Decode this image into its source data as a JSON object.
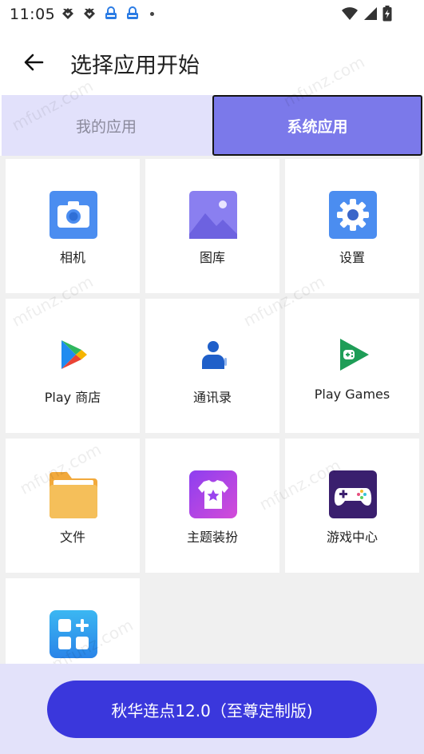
{
  "status_bar": {
    "time": "11:05"
  },
  "header": {
    "title": "选择应用开始"
  },
  "tabs": [
    {
      "label": "我的应用",
      "active": false
    },
    {
      "label": "系统应用",
      "active": true
    }
  ],
  "apps": [
    {
      "label": "相机",
      "icon": "camera-icon"
    },
    {
      "label": "图库",
      "icon": "gallery-icon"
    },
    {
      "label": "设置",
      "icon": "settings-gear-icon"
    },
    {
      "label": "Play 商店",
      "icon": "play-store-icon"
    },
    {
      "label": "通讯录",
      "icon": "contacts-icon"
    },
    {
      "label": "Play Games",
      "icon": "play-games-icon"
    },
    {
      "label": "文件",
      "icon": "files-folder-icon"
    },
    {
      "label": "主题装扮",
      "icon": "themes-shirt-icon"
    },
    {
      "label": "游戏中心",
      "icon": "gamepad-icon"
    },
    {
      "label": "",
      "icon": "app-grid-plus-icon"
    }
  ],
  "watermark": "mfunz.com",
  "bottom": {
    "button_label": "秋华连点12.0（至尊定制版)"
  },
  "colors": {
    "accent": "#3a37dc",
    "tab_active": "#7b79ea",
    "tab_bar": "#e2e1fb"
  }
}
